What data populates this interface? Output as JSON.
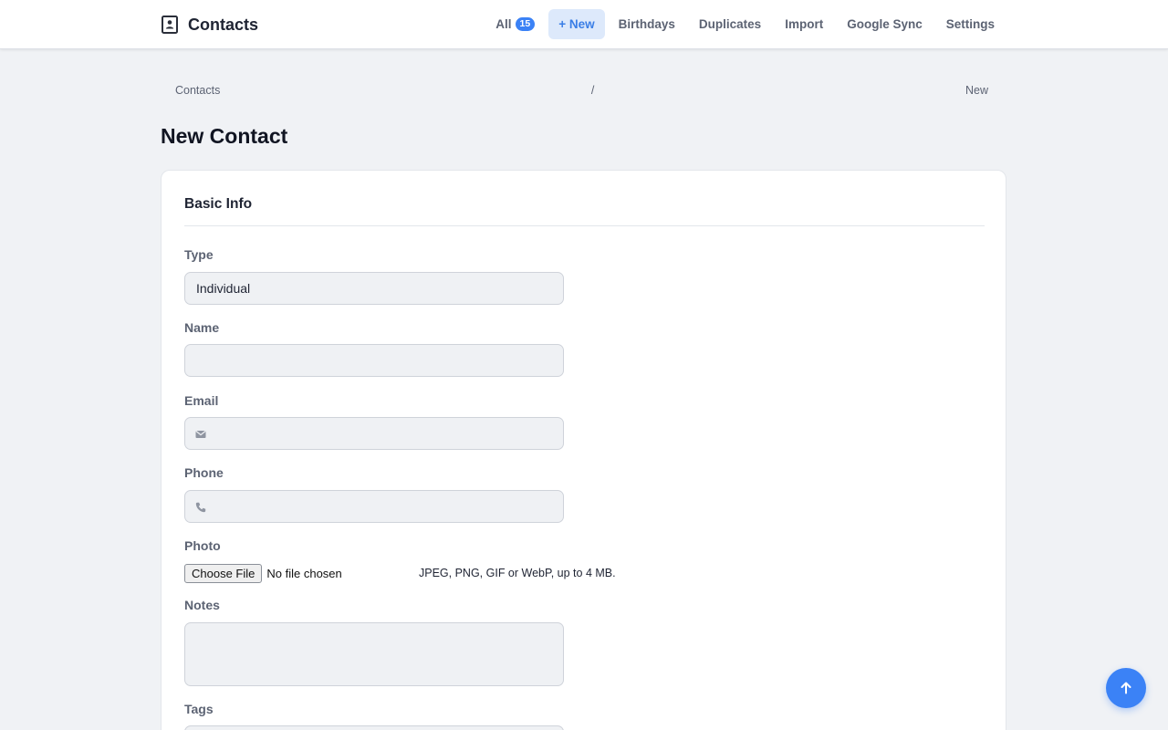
{
  "app": {
    "title": "Contacts",
    "brand_icon": "contact-book-icon"
  },
  "nav": {
    "all_label": "All",
    "all_count": "15",
    "new_label": "+ New",
    "birthdays_label": "Birthdays",
    "duplicates_label": "Duplicates",
    "import_label": "Import",
    "google_sync_label": "Google Sync",
    "settings_label": "Settings"
  },
  "breadcrumb": {
    "root": "Contacts",
    "separator": "/",
    "current": "New"
  },
  "page": {
    "title": "New Contact"
  },
  "form": {
    "section_title": "Basic Info",
    "type_label": "Type",
    "type_value": "Individual",
    "name_label": "Name",
    "name_value": "",
    "email_label": "Email",
    "email_value": "",
    "email_icon": "envelope-icon",
    "phone_label": "Phone",
    "phone_value": "",
    "phone_icon": "phone-icon",
    "photo_label": "Photo",
    "photo_button": "Choose File",
    "photo_status": "No file chosen",
    "photo_help": "JPEG, PNG, GIF or WebP, up to 4 MB.",
    "notes_label": "Notes",
    "notes_value": "",
    "tags_label": "Tags"
  },
  "fab": {
    "icon": "arrow-up-icon"
  },
  "colors": {
    "accent": "#3b82f6",
    "nav_active_bg": "#dde9fb",
    "page_bg": "#f0f2f5",
    "input_bg": "#eff1f4"
  }
}
